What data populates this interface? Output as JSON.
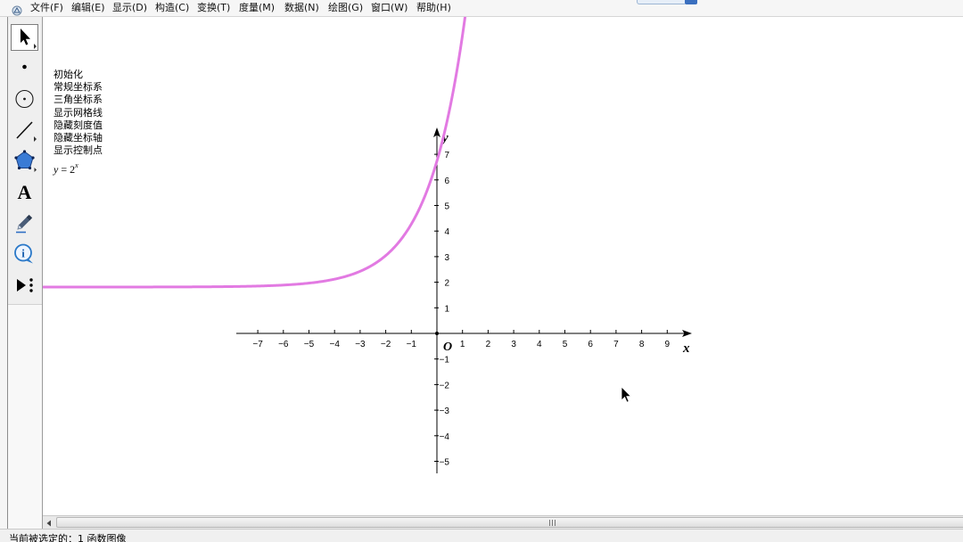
{
  "app": {
    "icon": "sketchpad-app-icon"
  },
  "menu_bar": {
    "items": [
      "文件(F)",
      "编辑(E)",
      "显示(D)",
      "构造(C)",
      "变换(T)",
      "度量(M)",
      "数据(N)",
      "绘图(G)",
      "窗口(W)",
      "帮助(H)"
    ]
  },
  "toolbar": {
    "tools": [
      {
        "icon": "arrow-icon",
        "selected": true
      },
      {
        "icon": "point-icon"
      },
      {
        "icon": "compass-circle-icon"
      },
      {
        "icon": "straightedge-line-icon"
      },
      {
        "icon": "polygon-icon"
      },
      {
        "icon": "text-icon",
        "glyph": "A"
      },
      {
        "icon": "marker-pen-icon"
      },
      {
        "icon": "information-icon",
        "glyph": "i"
      },
      {
        "icon": "custom-tools-icon"
      }
    ]
  },
  "sketch": {
    "action_buttons": [
      "初始化",
      "常规坐标系",
      "三角坐标系",
      "显示网格线",
      "隐藏刻度值",
      "隐藏坐标轴",
      "显示控制点"
    ],
    "function_label": {
      "lhs": "y",
      "rhs": " = 2",
      "exponent": "x"
    },
    "axes": {
      "origin_label": "O",
      "x_label": "x",
      "y_label": "y",
      "x_tick_labels": [
        "−7",
        "−6",
        "−5",
        "−4",
        "−3",
        "−2",
        "−1",
        "1",
        "2",
        "3",
        "4",
        "5",
        "6",
        "7",
        "8",
        "9"
      ],
      "y_tick_labels": [
        "7",
        "6",
        "5",
        "4",
        "3",
        "2",
        "1",
        "−1",
        "−2",
        "−3",
        "−4",
        "−5"
      ]
    },
    "graph": {
      "color": "#e27ae2",
      "axis_color": "#000000"
    }
  },
  "scrollbar": {
    "left_arrow_icon": "scroll-left-arrow-icon"
  },
  "status_bar": {
    "text": "当前被选定的：1 函数图像"
  }
}
